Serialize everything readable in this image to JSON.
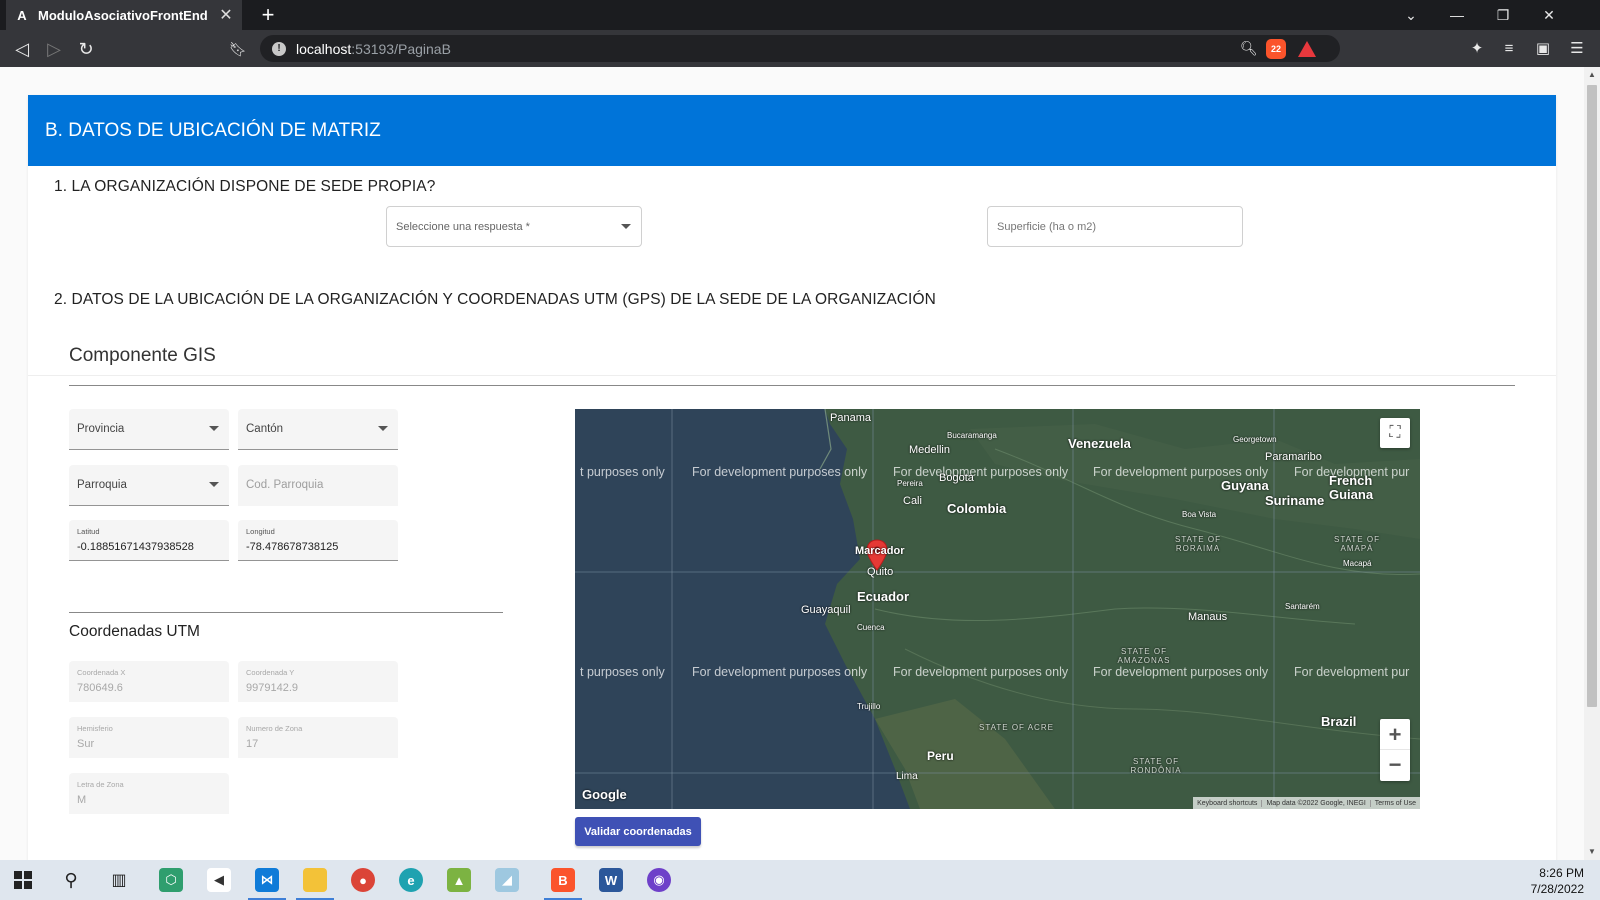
{
  "browser": {
    "tab_title": "ModuloAsociativoFrontEnd",
    "tab_favicon": "A",
    "url_host": "localhost",
    "url_path": ":53193/PaginaB",
    "shields_count": "22"
  },
  "page": {
    "section_header": "B. DATOS DE UBICACIÓN DE MATRIZ",
    "question1": "1. LA ORGANIZACIÓN DISPONE DE SEDE PROPIA?",
    "select_respuesta_label": "Seleccione una respuesta *",
    "superficie_placeholder": "Superficie (ha o m2)",
    "question2": "2. DATOS DE LA UBICACIÓN DE LA ORGANIZACIÓN Y COORDENADAS UTM (GPS) DE LA SEDE DE LA ORGANIZACIÓN",
    "gis_title": "Componente GIS",
    "provincia_label": "Provincia",
    "canton_label": "Cantón",
    "parroquia_label": "Parroquia",
    "cod_parroquia_placeholder": "Cod. Parroquia",
    "latitud_label": "Latitud",
    "latitud_value": "-0.18851671437938528",
    "longitud_label": "Longitud",
    "longitud_value": "-78.478678738125",
    "utm_title": "Coordenadas UTM",
    "coord_x_label": "Coordenada X",
    "coord_x_value": "780649.6",
    "coord_y_label": "Coordenada Y",
    "coord_y_value": "9979142.9",
    "hemisferio_label": "Hemisferio",
    "hemisferio_value": "Sur",
    "numero_zona_label": "Numero de Zona",
    "numero_zona_value": "17",
    "letra_zona_label": "Letra de Zona",
    "letra_zona_value": "M",
    "validar_button": "Validar coordenadas"
  },
  "map": {
    "watermark": "For development purposes only",
    "watermark_cut_left": "t purposes only",
    "watermark_cut_right": "For development pur",
    "marker_label": "Marcador",
    "places": {
      "panama": "Panama",
      "bucaramanga": "Bucaramanga",
      "medellin": "Medellin",
      "venezuela": "Venezuela",
      "georgetown": "Georgetown",
      "paramaribo": "Paramaribo",
      "bogota": "Bogota",
      "pereira": "Pereira",
      "guyana": "Guyana",
      "suriname": "Suriname",
      "french_guiana": "French Guiana",
      "cali": "Cali",
      "colombia": "Colombia",
      "boa_vista": "Boa Vista",
      "roraima": "STATE OF RORAIMA",
      "amapa": "STATE OF AMAPÁ",
      "macapa": "Macapá",
      "quito": "Quito",
      "ecuador": "Ecuador",
      "guayaquil": "Guayaquil",
      "cuenca": "Cuenca",
      "manaus": "Manaus",
      "santarem": "Santarém",
      "amazonas": "STATE OF AMAZONAS",
      "trujillo": "Trujillo",
      "acre": "STATE OF ACRE",
      "brazil": "Brazil",
      "peru": "Peru",
      "rondonia": "STATE OF RONDÔNIA",
      "lima": "Lima"
    },
    "google_logo": "Google",
    "attribution_shortcuts": "Keyboard shortcuts",
    "attribution_data": "Map data ©2022 Google, INEGI",
    "attribution_terms": "Terms of Use"
  },
  "taskbar": {
    "time": "8:26 PM",
    "date": "7/28/2022"
  },
  "colors": {
    "header_blue": "#0074d9",
    "button_indigo": "#3f51b5",
    "marker_red": "#e53935"
  }
}
